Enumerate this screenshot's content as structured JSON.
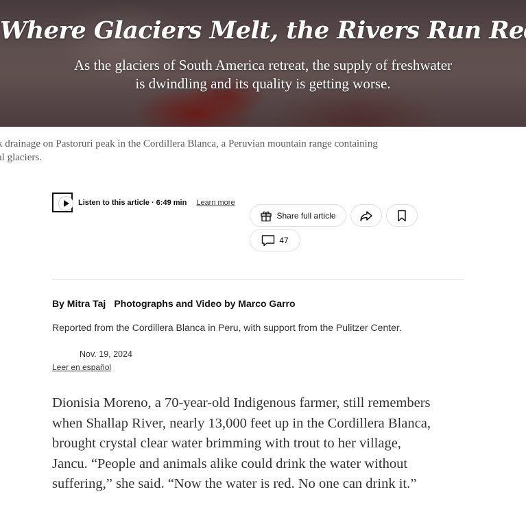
{
  "hero": {
    "title": "Where Glaciers Melt, the Rivers Run Red",
    "subtitle_lines": [
      "As the glaciers of South America retreat, the supply of freshwater",
      "is dwindling and its quality is getting worse."
    ]
  },
  "caption_lines": [
    "k drainage on Pastoruri peak in the Cordillera Blanca, a Peruvian mountain range containing",
    "al glaciers."
  ],
  "listen": {
    "label": "Listen to this article · 6:49 min",
    "learn_more": "Learn more"
  },
  "actions": {
    "share_label": "Share full article",
    "comments_count": "47",
    "forward_icon": "share-arrow-icon",
    "save_icon": "bookmark-icon"
  },
  "byline": {
    "author": "By Mitra Taj",
    "photos": "Photographs and Video by Marco Garro"
  },
  "reported_from": "Reported from the Cordillera Blanca in Peru, with support from the Pulitzer Center.",
  "date": "Nov. 19, 2024",
  "spanish_link": "Leer en español",
  "body_lines": [
    "Dionisia Moreno, a 70-year-old Indigenous farmer, still remembers",
    "when Shallap River, nearly 13,000 feet up in the Cordillera Blanca,",
    "brought crystal clear water brimming with trout to her village,",
    "Jancu. “People and animals alike could drink the water without",
    "suffering,” she said. “Now the water is red. No one can drink it.”"
  ]
}
